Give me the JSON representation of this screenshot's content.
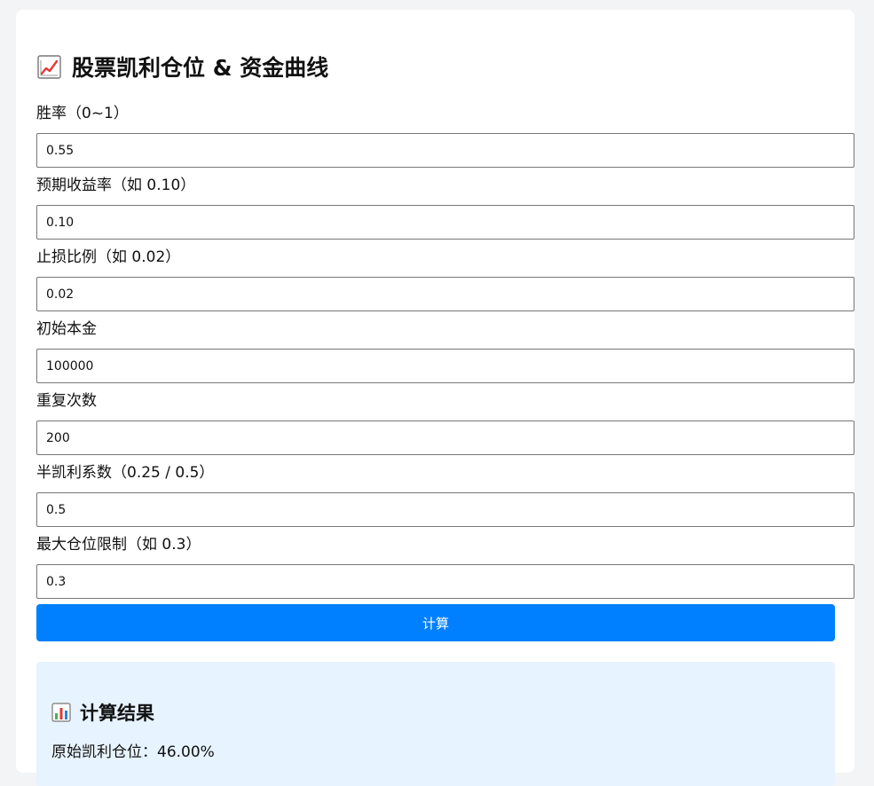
{
  "header": {
    "title": "股票凯利仓位 & 资金曲线",
    "title_icon": "chart-increasing-icon"
  },
  "form": {
    "fields": [
      {
        "label": "胜率（0~1）",
        "value": "0.55"
      },
      {
        "label": "预期收益率（如 0.10）",
        "value": "0.10"
      },
      {
        "label": "止损比例（如 0.02）",
        "value": "0.02"
      },
      {
        "label": "初始本金",
        "value": "100000"
      },
      {
        "label": "重复次数",
        "value": "200"
      },
      {
        "label": "半凯利系数（0.25 / 0.5）",
        "value": "0.5"
      },
      {
        "label": "最大仓位限制（如 0.3）",
        "value": "0.3"
      }
    ],
    "submit_label": "计算"
  },
  "result": {
    "title": "计算结果",
    "title_icon": "bar-chart-icon",
    "line": "原始凯利仓位：46.00%"
  },
  "colors": {
    "page_background": "#f3f4f6",
    "card_background": "#ffffff",
    "button_blue": "#0080ff",
    "result_background": "#e7f3ff",
    "chart_red": "#e53935"
  }
}
